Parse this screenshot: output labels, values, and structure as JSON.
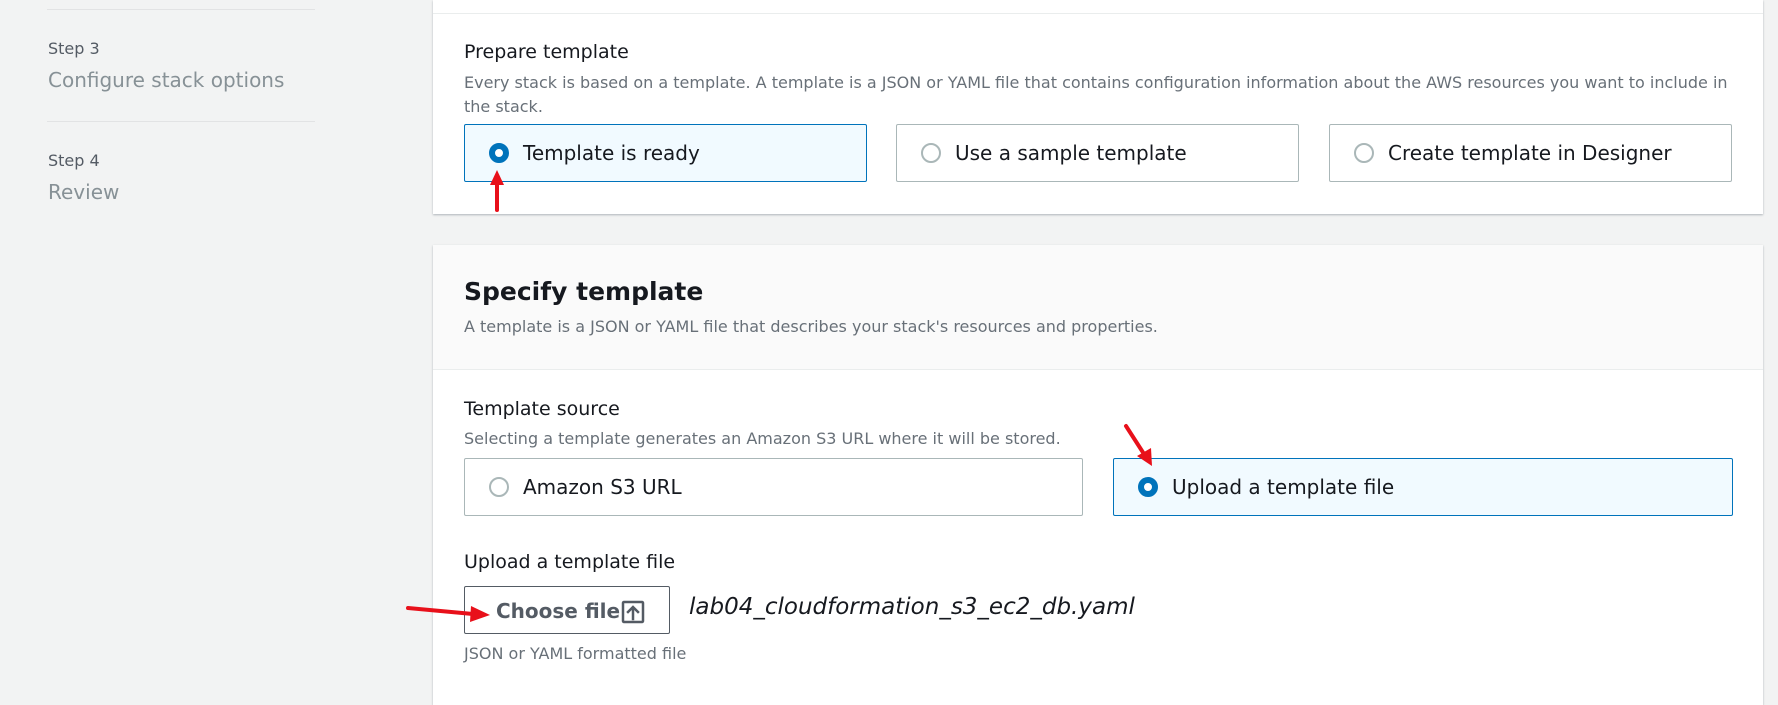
{
  "sidebar": {
    "steps": [
      {
        "label": "Step 3",
        "title": "Configure stack options"
      },
      {
        "label": "Step 4",
        "title": "Review"
      }
    ]
  },
  "prepare_template": {
    "heading": "Prepare template",
    "description": "Every stack is based on a template. A template is a JSON or YAML file that contains configuration information about the AWS resources you want to include in the stack.",
    "options": [
      {
        "label": "Template is ready",
        "selected": true
      },
      {
        "label": "Use a sample template",
        "selected": false
      },
      {
        "label": "Create template in Designer",
        "selected": false
      }
    ]
  },
  "specify_template": {
    "heading": "Specify template",
    "description": "A template is a JSON or YAML file that describes your stack's resources and properties.",
    "source_label": "Template source",
    "source_description": "Selecting a template generates an Amazon S3 URL where it will be stored.",
    "source_options": [
      {
        "label": "Amazon S3 URL",
        "selected": false
      },
      {
        "label": "Upload a template file",
        "selected": true
      }
    ],
    "upload_label": "Upload a template file",
    "choose_file_label": "Choose file",
    "file_name": "lab04_cloudformation_s3_ec2_db.yaml",
    "upload_hint": "JSON or YAML formatted file"
  },
  "annotation_color": "#e8101a",
  "accent_color": "#0073bb",
  "icons": {
    "upload": "upload-icon"
  }
}
